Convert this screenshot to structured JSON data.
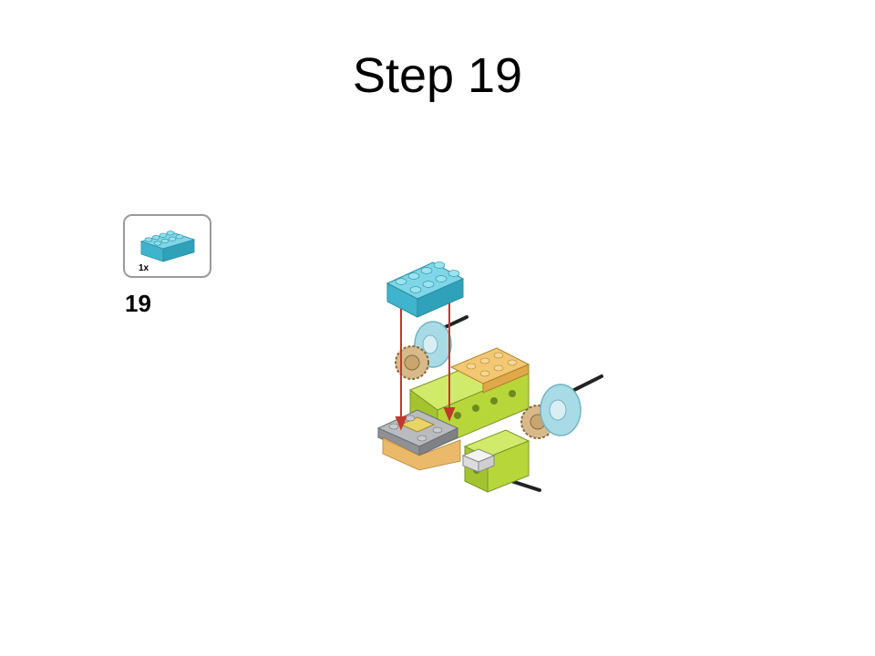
{
  "slide": {
    "title": "Step 19"
  },
  "instruction": {
    "step_number": "19",
    "parts": [
      {
        "quantity": "1x",
        "part": "azure-2x4-brick-icon",
        "color": "#4fc3d9"
      }
    ]
  },
  "colors": {
    "brick_azure": "#4fc3d9",
    "lime": "#b7d63a",
    "orange": "#e8b25a",
    "gray_plate": "#a7a9ad",
    "arrow_red": "#c0392b",
    "gear_tan": "#d8b98a",
    "wheel_blue": "#a9dbe6"
  }
}
